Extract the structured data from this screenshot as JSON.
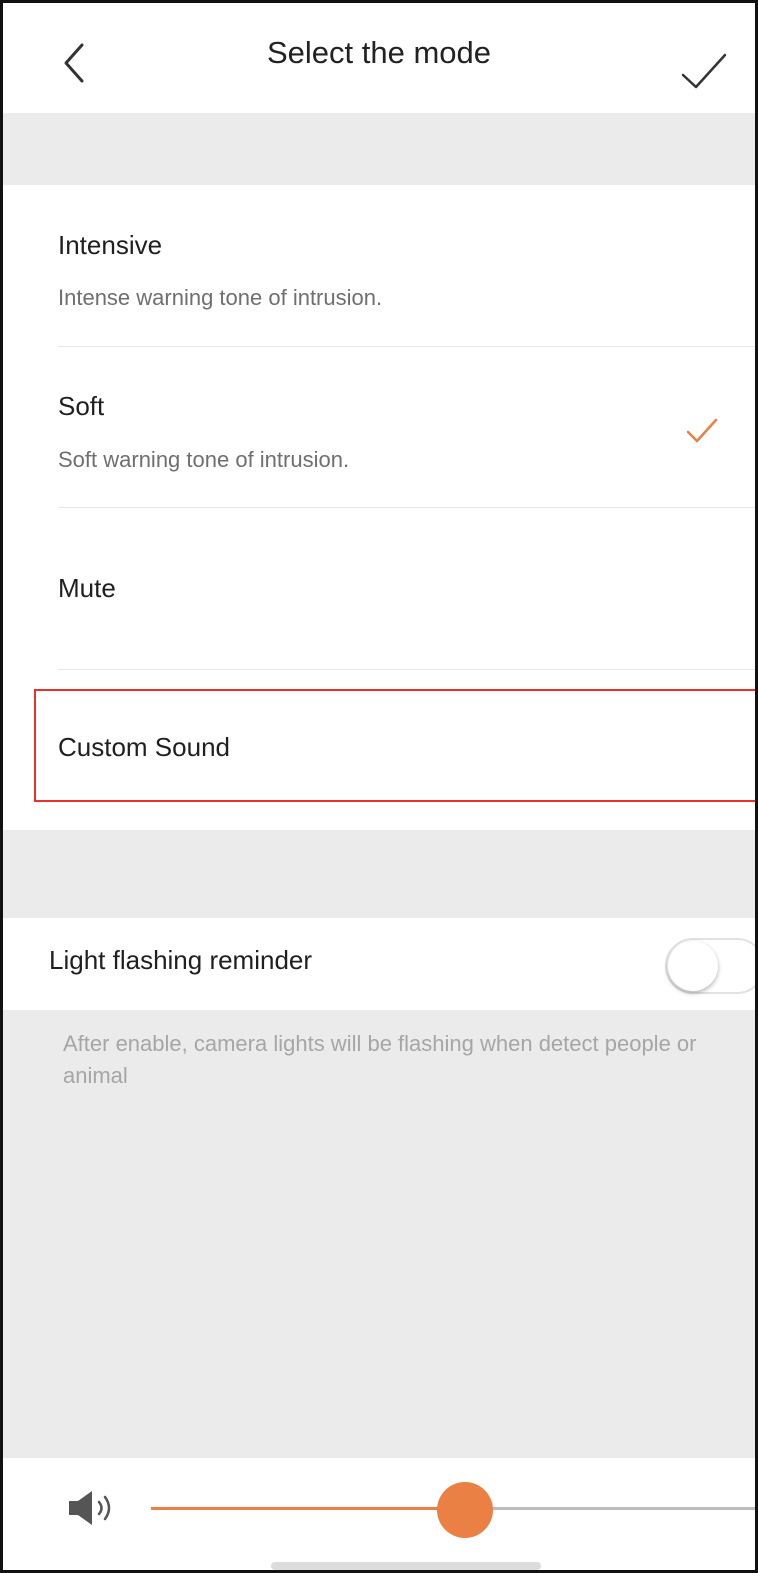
{
  "header": {
    "title": "Select the mode",
    "back_icon": "chevron-left-icon",
    "confirm_icon": "checkmark-icon"
  },
  "modes": [
    {
      "title": "Intensive",
      "subtitle": "Intense warning tone of intrusion.",
      "selected": false
    },
    {
      "title": "Soft",
      "subtitle": "Soft warning tone of intrusion.",
      "selected": true
    },
    {
      "title": "Mute",
      "subtitle": "",
      "selected": false
    },
    {
      "title": "Custom Sound",
      "subtitle": "",
      "selected": false,
      "highlighted": true
    }
  ],
  "light_flashing": {
    "label": "Light flashing reminder",
    "enabled": false,
    "hint": "After enable, camera lights will be flashing when detect people or animal"
  },
  "volume": {
    "icon": "speaker-icon",
    "level": 0.52
  },
  "colors": {
    "accent": "#EA8043",
    "highlight_border": "#E8312B",
    "background": "#EBEBEB"
  }
}
